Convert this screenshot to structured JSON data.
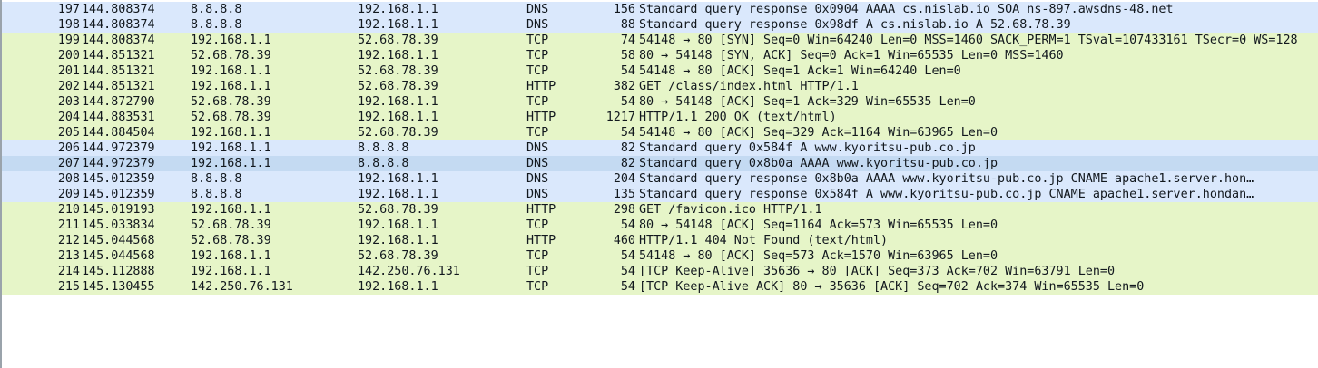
{
  "packets": [
    {
      "no": "197",
      "time": "144.808374",
      "source": "8.8.8.8",
      "destination": "192.168.1.1",
      "protocol": "DNS",
      "length": "156",
      "info": "Standard query response 0x0904 AAAA cs.nislab.io SOA ns-897.awsdns-48.net"
    },
    {
      "no": "198",
      "time": "144.808374",
      "source": "8.8.8.8",
      "destination": "192.168.1.1",
      "protocol": "DNS",
      "length": "88",
      "info": "Standard query response 0x98df A cs.nislab.io A 52.68.78.39"
    },
    {
      "no": "199",
      "time": "144.808374",
      "source": "192.168.1.1",
      "destination": "52.68.78.39",
      "protocol": "TCP",
      "length": "74",
      "info": "54148 → 80 [SYN] Seq=0 Win=64240 Len=0 MSS=1460 SACK_PERM=1 TSval=107433161 TSecr=0 WS=128"
    },
    {
      "no": "200",
      "time": "144.851321",
      "source": "52.68.78.39",
      "destination": "192.168.1.1",
      "protocol": "TCP",
      "length": "58",
      "info": "80 → 54148 [SYN, ACK] Seq=0 Ack=1 Win=65535 Len=0 MSS=1460"
    },
    {
      "no": "201",
      "time": "144.851321",
      "source": "192.168.1.1",
      "destination": "52.68.78.39",
      "protocol": "TCP",
      "length": "54",
      "info": "54148 → 80 [ACK] Seq=1 Ack=1 Win=64240 Len=0"
    },
    {
      "no": "202",
      "time": "144.851321",
      "source": "192.168.1.1",
      "destination": "52.68.78.39",
      "protocol": "HTTP",
      "length": "382",
      "info": "GET /class/index.html HTTP/1.1"
    },
    {
      "no": "203",
      "time": "144.872790",
      "source": "52.68.78.39",
      "destination": "192.168.1.1",
      "protocol": "TCP",
      "length": "54",
      "info": "80 → 54148 [ACK] Seq=1 Ack=329 Win=65535 Len=0"
    },
    {
      "no": "204",
      "time": "144.883531",
      "source": "52.68.78.39",
      "destination": "192.168.1.1",
      "protocol": "HTTP",
      "length": "1217",
      "info": "HTTP/1.1 200 OK  (text/html)"
    },
    {
      "no": "205",
      "time": "144.884504",
      "source": "192.168.1.1",
      "destination": "52.68.78.39",
      "protocol": "TCP",
      "length": "54",
      "info": "54148 → 80 [ACK] Seq=329 Ack=1164 Win=63965 Len=0"
    },
    {
      "no": "206",
      "time": "144.972379",
      "source": "192.168.1.1",
      "destination": "8.8.8.8",
      "protocol": "DNS",
      "length": "82",
      "info": "Standard query 0x584f A www.kyoritsu-pub.co.jp"
    },
    {
      "no": "207",
      "time": "144.972379",
      "source": "192.168.1.1",
      "destination": "8.8.8.8",
      "protocol": "DNS",
      "length": "82",
      "info": "Standard query 0x8b0a AAAA www.kyoritsu-pub.co.jp"
    },
    {
      "no": "208",
      "time": "145.012359",
      "source": "8.8.8.8",
      "destination": "192.168.1.1",
      "protocol": "DNS",
      "length": "204",
      "info": "Standard query response 0x8b0a AAAA www.kyoritsu-pub.co.jp CNAME apache1.server.hon…"
    },
    {
      "no": "209",
      "time": "145.012359",
      "source": "8.8.8.8",
      "destination": "192.168.1.1",
      "protocol": "DNS",
      "length": "135",
      "info": "Standard query response 0x584f A www.kyoritsu-pub.co.jp CNAME apache1.server.hondan…"
    },
    {
      "no": "210",
      "time": "145.019193",
      "source": "192.168.1.1",
      "destination": "52.68.78.39",
      "protocol": "HTTP",
      "length": "298",
      "info": "GET /favicon.ico HTTP/1.1"
    },
    {
      "no": "211",
      "time": "145.033834",
      "source": "52.68.78.39",
      "destination": "192.168.1.1",
      "protocol": "TCP",
      "length": "54",
      "info": "80 → 54148 [ACK] Seq=1164 Ack=573 Win=65535 Len=0"
    },
    {
      "no": "212",
      "time": "145.044568",
      "source": "52.68.78.39",
      "destination": "192.168.1.1",
      "protocol": "HTTP",
      "length": "460",
      "info": "HTTP/1.1 404 Not Found  (text/html)"
    },
    {
      "no": "213",
      "time": "145.044568",
      "source": "192.168.1.1",
      "destination": "52.68.78.39",
      "protocol": "TCP",
      "length": "54",
      "info": "54148 → 80 [ACK] Seq=573 Ack=1570 Win=63965 Len=0"
    },
    {
      "no": "214",
      "time": "145.112888",
      "source": "192.168.1.1",
      "destination": "142.250.76.131",
      "protocol": "TCP",
      "length": "54",
      "info": "[TCP Keep-Alive] 35636 → 80 [ACK] Seq=373 Ack=702 Win=63791 Len=0"
    },
    {
      "no": "215",
      "time": "145.130455",
      "source": "142.250.76.131",
      "destination": "192.168.1.1",
      "protocol": "TCP",
      "length": "54",
      "info": "[TCP Keep-Alive ACK] 80 → 35636 [ACK] Seq=702 Ack=374 Win=65535 Len=0"
    }
  ],
  "selected_row": "207",
  "colors": {
    "dns_row": "#dae8fc",
    "tcp_row": "#e6f5c8",
    "selected_row": "#c4daf2",
    "text": "#12181e"
  }
}
